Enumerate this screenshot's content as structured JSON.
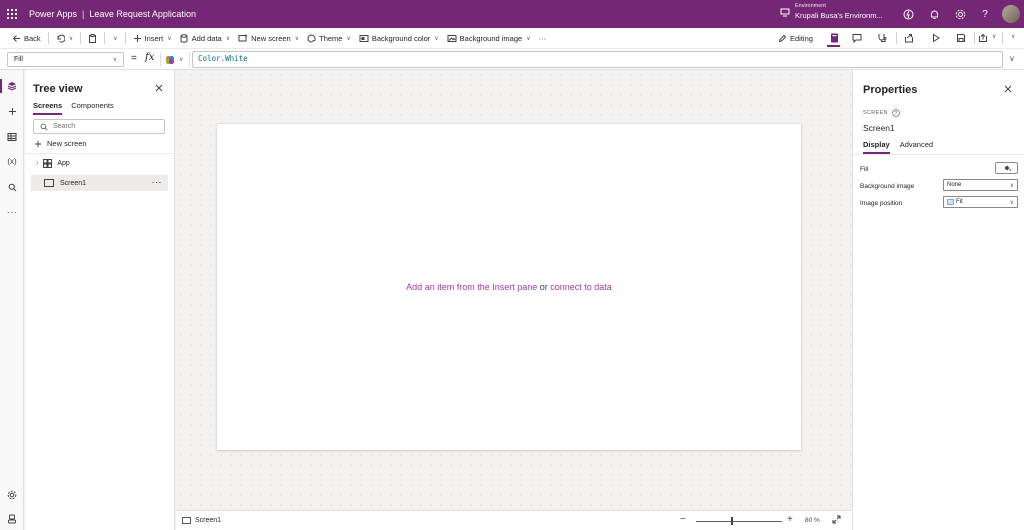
{
  "topbar": {
    "product": "Power Apps",
    "separator": "|",
    "app_name": "Leave Request Application",
    "environment_label": "Environment",
    "environment_name": "Krupali Busa's Environm..."
  },
  "commandbar": {
    "back": "Back",
    "insert": "Insert",
    "add_data": "Add data",
    "new_screen": "New screen",
    "theme": "Theme",
    "background_color": "Background color",
    "background_image": "Background image",
    "more": "···",
    "editing": "Editing"
  },
  "formulabar": {
    "property": "Fill",
    "equals": "=",
    "fx": "fx",
    "formula": "Color.White"
  },
  "treeview": {
    "title": "Tree view",
    "tabs": [
      "Screens",
      "Components"
    ],
    "search_placeholder": "Search",
    "new_screen": "New screen",
    "items": [
      {
        "label": "App"
      },
      {
        "label": "Screen1",
        "more": "···"
      }
    ]
  },
  "canvas": {
    "message_prefix": "Add an item from the Insert pane",
    "message_or": " or ",
    "message_link": "connect to data"
  },
  "statusbar": {
    "screen": "Screen1",
    "zoom": "80  %"
  },
  "properties": {
    "title": "Properties",
    "type": "SCREEN",
    "name": "Screen1",
    "tabs": [
      "Display",
      "Advanced"
    ],
    "fill_label": "Fill",
    "background_image_label": "Background image",
    "background_image_value": "None",
    "image_position_label": "Image position",
    "image_position_value": "Fit"
  },
  "colors": {
    "brand": "#742774",
    "link": "#a53aa0"
  }
}
